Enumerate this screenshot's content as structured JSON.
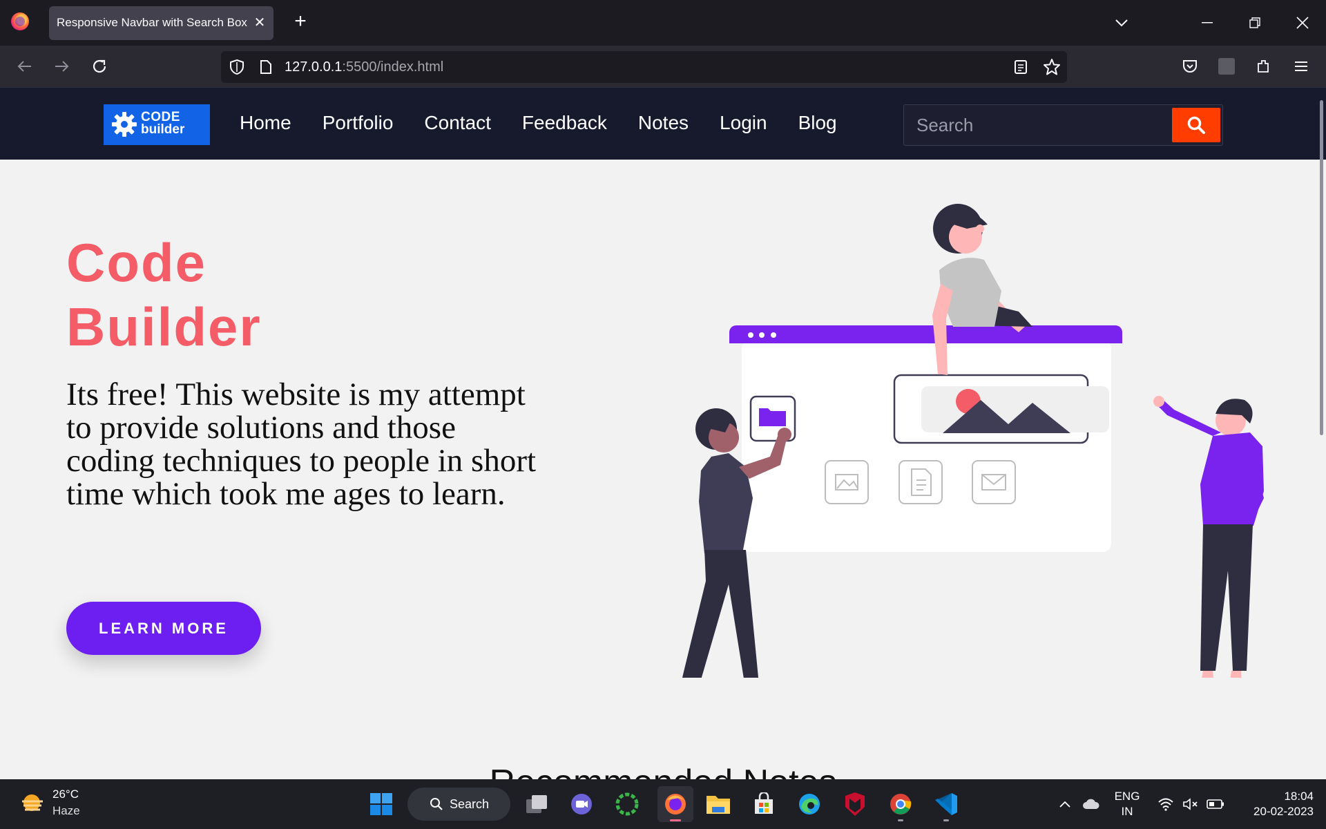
{
  "browser": {
    "tab_title": "Responsive Navbar with Search Box",
    "url_host": "127.0.0.1",
    "url_rest": ":5500/index.html"
  },
  "site": {
    "logo": {
      "line1": "CODE",
      "line2": "builder"
    },
    "nav_links": [
      "Home",
      "Portfolio",
      "Contact",
      "Feedback",
      "Notes",
      "Login",
      "Blog"
    ],
    "search_placeholder": "Search",
    "hero_title_line1": "Code",
    "hero_title_line2": "Builder",
    "hero_text": "Its free! This website is my attempt to provide solutions and those coding techniques to people in short time which took me ages to learn.",
    "learn_more": "LEARN MORE",
    "section_heading": "Recommended Notes",
    "colors": {
      "accent": "#6c1ff0",
      "title": "#f45d68",
      "search_button": "#ff3d00",
      "nav_bg": "#171a2d"
    }
  },
  "taskbar": {
    "weather_temp": "26°C",
    "weather_cond": "Haze",
    "search_label": "Search",
    "lang_line1": "ENG",
    "lang_line2": "IN",
    "time": "18:04",
    "date": "20-02-2023"
  }
}
